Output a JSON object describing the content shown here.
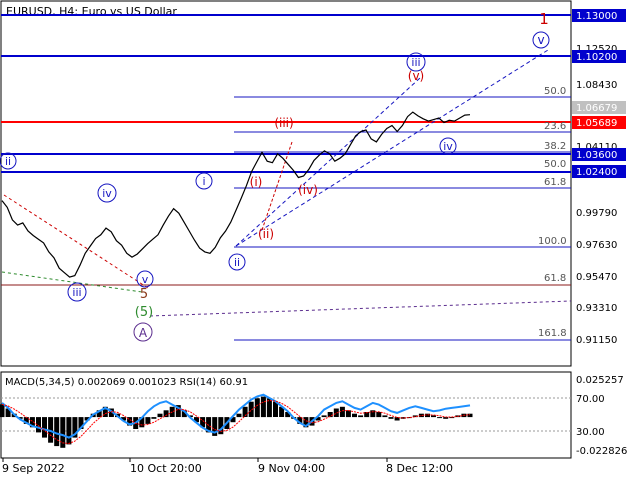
{
  "chart_data": {
    "type": "line",
    "title": "EURUSD, H4:  Euro vs US Dollar",
    "x_ticks": [
      "9 Sep 2022",
      "10 Oct 20:00",
      "9 Nov 04:00",
      "8 Dec 12:00"
    ],
    "price_scale": {
      "ylim": [
        0.8977,
        1.1426
      ],
      "ticks": [
        "1.12520",
        "1.10200",
        "1.08430",
        "1.06679",
        "1.05689",
        "1.04110",
        "1.03600",
        "1.02400",
        "0.99790",
        "0.97630",
        "0.95470",
        "0.93310",
        "0.91150"
      ]
    },
    "series": [
      {
        "values": [
          1.009,
          1.0045,
          0.996,
          0.9925,
          0.994,
          0.9885,
          0.9855,
          0.983,
          0.9805,
          0.9745,
          0.9705,
          0.9635,
          0.9605,
          0.9575,
          0.9585,
          0.9655,
          0.9735,
          0.9785,
          0.9835,
          0.986,
          0.9905,
          0.988,
          0.982,
          0.979,
          0.9735,
          0.971,
          0.973,
          0.9765,
          0.98,
          0.983,
          0.986,
          0.9925,
          0.9985,
          1.0035,
          1.0005,
          0.9945,
          0.9885,
          0.9825,
          0.977,
          0.9745,
          0.9735,
          0.9775,
          0.984,
          0.9885,
          0.9945,
          1.0025,
          1.0105,
          1.019,
          1.0285,
          1.035,
          1.0415,
          1.0355,
          1.0345,
          1.0405,
          1.0375,
          1.0335,
          1.0295,
          1.0245,
          1.0255,
          1.03,
          1.036,
          1.0395,
          1.0425,
          1.0405,
          1.0355,
          1.0375,
          1.0405,
          1.0465,
          1.0525,
          1.0555,
          1.0565,
          1.0505,
          1.0485,
          1.0535,
          1.0575,
          1.0595,
          1.0555,
          1.0595,
          1.0655,
          1.0685,
          1.066,
          1.064,
          1.0625,
          1.0635,
          1.0645,
          1.0615,
          1.063,
          1.0625,
          1.0645,
          1.0665,
          1.0668
        ]
      }
    ],
    "price_labels": [
      {
        "text": "1.13000",
        "y": 1.13,
        "boxed": true,
        "bg": "#0000cd"
      },
      {
        "text": "1.10200",
        "y": 1.102,
        "boxed": true,
        "bg": "#0000cd"
      },
      {
        "text": "1.06679",
        "y": 1.06679,
        "boxed": true,
        "bg": "#c0c0c0"
      },
      {
        "text": "1.05689",
        "y": 1.05689,
        "boxed": true,
        "bg": "#ff0000"
      },
      {
        "text": "1.03600",
        "y": 1.036,
        "boxed": true,
        "bg": "#0000cd"
      },
      {
        "text": "1.02400",
        "y": 1.024,
        "boxed": true,
        "bg": "#0000cd"
      }
    ],
    "fib_labels": [
      {
        "text": "50.0",
        "y": 1.0733
      },
      {
        "text": "23.6",
        "y": 1.0566
      },
      {
        "text": "38.2",
        "y": 1.0427
      },
      {
        "text": "50.0",
        "y": 1.036
      },
      {
        "text": "61.8",
        "y": 1.0201
      },
      {
        "text": "100.0",
        "y": 0.977
      },
      {
        "text": "61.8",
        "y": 0.9477
      },
      {
        "text": "161.8",
        "y": 0.918
      }
    ],
    "wave_labels": [
      {
        "text": "1",
        "color": "#cc0000"
      },
      {
        "text": "v",
        "color": "#1515c0",
        "circled": true
      },
      {
        "text": "iii",
        "color": "#1515c0",
        "circled": true
      },
      {
        "text": "(v)",
        "color": "#cc0000"
      },
      {
        "text": "(iii)",
        "color": "#cc0000"
      },
      {
        "text": "iv",
        "color": "#1515c0",
        "circled": true
      },
      {
        "text": "(iv)",
        "color": "#cc0000"
      },
      {
        "text": "(i)",
        "color": "#cc0000"
      },
      {
        "text": "(ii)",
        "color": "#cc0000"
      },
      {
        "text": "i",
        "color": "#1515c0",
        "circled": true
      },
      {
        "text": "ii",
        "color": "#1515c0",
        "circled": true
      },
      {
        "text": "ii",
        "color": "#1515c0",
        "circled": true
      },
      {
        "text": "iv",
        "color": "#1515c0",
        "circled": true
      },
      {
        "text": "v",
        "color": "#1515c0",
        "circled": true
      },
      {
        "text": "iii",
        "color": "#1515c0",
        "circled": true
      },
      {
        "text": "5",
        "color": "#8b3a1a"
      },
      {
        "text": "(5)",
        "color": "#2e8b2e"
      },
      {
        "text": "A",
        "color": "#5b2d8e",
        "circled": true
      }
    ],
    "indicator": {
      "label": "MACD(5,34,5) 0.002069 0.001023 RSI(14) 60.91",
      "ticks": [
        "0.025257",
        "70.00",
        "30.00",
        "-0.022826"
      ],
      "ylim": [
        -0.022826,
        0.025257
      ],
      "macd": [
        0.0075,
        0.005,
        0.002,
        -0.001,
        -0.004,
        -0.006,
        -0.009,
        -0.012,
        -0.015,
        -0.017,
        -0.018,
        -0.016,
        -0.012,
        -0.007,
        -0.002,
        0.002,
        0.004,
        0.006,
        0.005,
        0.002,
        -0.002,
        -0.005,
        -0.007,
        -0.006,
        -0.004,
        -0.001,
        0.002,
        0.004,
        0.006,
        0.007,
        0.004,
        0.001,
        -0.003,
        -0.006,
        -0.009,
        -0.011,
        -0.01,
        -0.007,
        -0.003,
        0.002,
        0.006,
        0.009,
        0.011,
        0.012,
        0.011,
        0.009,
        0.006,
        0.003,
        -0.001,
        -0.004,
        -0.006,
        -0.005,
        -0.002,
        0.001,
        0.003,
        0.005,
        0.006,
        0.004,
        0.002,
        0.001,
        0.003,
        0.004,
        0.003,
        0.001,
        -0.001,
        -0.002,
        -0.001,
        0.0,
        0.001,
        0.002,
        0.002,
        0.001,
        0.0,
        -0.001,
        0.0,
        0.001,
        0.002,
        0.002
      ],
      "rsi": [
        64,
        58,
        50,
        44,
        40,
        36,
        34,
        32,
        30,
        27,
        25,
        22,
        26,
        34,
        42,
        50,
        54,
        58,
        54,
        48,
        42,
        38,
        40,
        46,
        54,
        60,
        64,
        66,
        62,
        58,
        54,
        46,
        40,
        34,
        30,
        28,
        32,
        40,
        48,
        56,
        62,
        68,
        72,
        74,
        70,
        66,
        60,
        54,
        46,
        40,
        36,
        42,
        48,
        56,
        60,
        64,
        66,
        62,
        58,
        56,
        60,
        64,
        62,
        58,
        54,
        52,
        55,
        58,
        60,
        58,
        56,
        54,
        55,
        57,
        58,
        59,
        60,
        61
      ]
    }
  }
}
